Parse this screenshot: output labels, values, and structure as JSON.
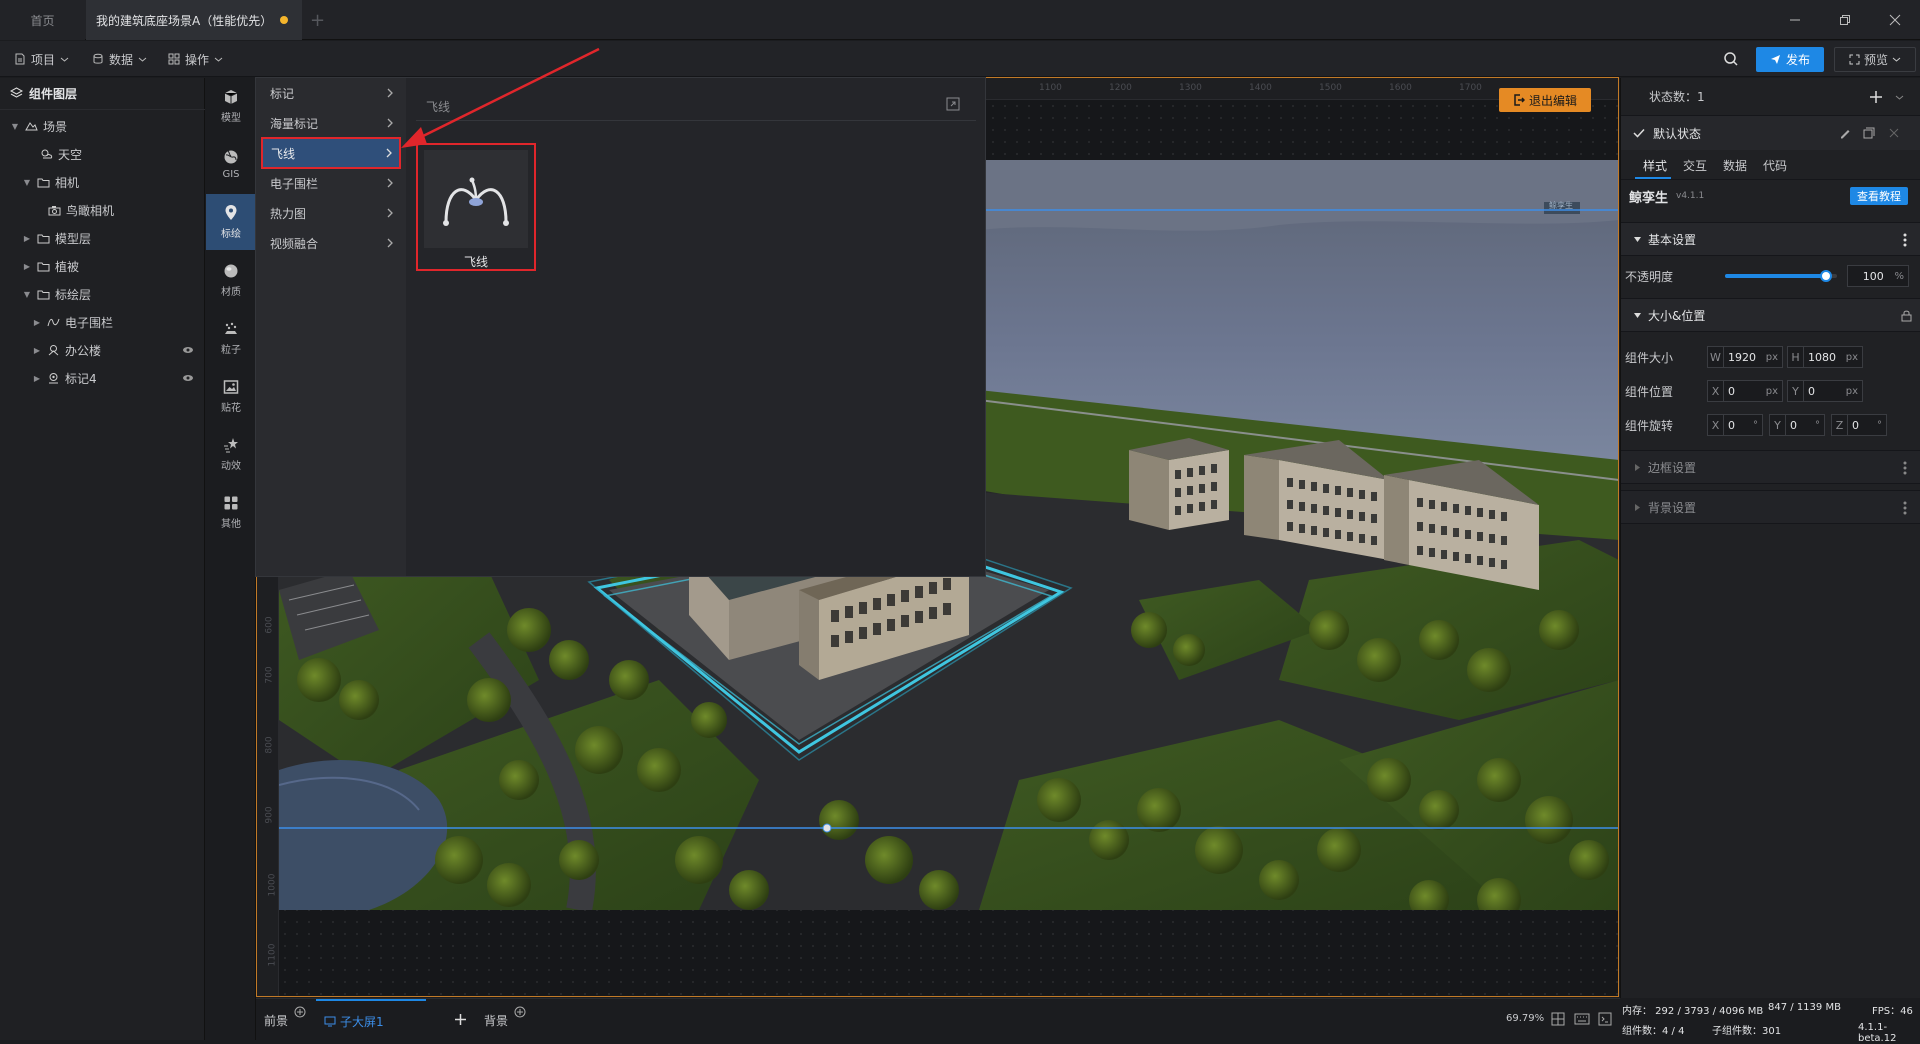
{
  "tabs": {
    "home": "首页",
    "active": "我的建筑底座场景A（性能优先）"
  },
  "toolbar": {
    "project": "项目",
    "data": "数据",
    "operate": "操作",
    "publish": "发布",
    "preview": "预览"
  },
  "layers": {
    "title": "组件图层",
    "items": [
      "场景",
      "天空",
      "相机",
      "鸟瞰相机",
      "模型层",
      "植被",
      "标绘层",
      "电子围栏",
      "办公楼",
      "标记4"
    ]
  },
  "iconbar": {
    "items": [
      "模型",
      "GIS",
      "标绘",
      "材质",
      "粒子",
      "贴花",
      "动效",
      "其他"
    ]
  },
  "flyout": {
    "menu": [
      "标记",
      "海量标记",
      "飞线",
      "电子围栏",
      "热力图",
      "视频融合"
    ],
    "panel_title": "飞线",
    "card_label": "飞线"
  },
  "canvas": {
    "exit_label": "退出编辑",
    "ruler_x": [
      "1100",
      "1200",
      "1300",
      "1400",
      "1500",
      "1600",
      "1700"
    ],
    "ruler_y": [
      "600",
      "700",
      "800",
      "900",
      "1000",
      "1100"
    ],
    "watermark": "鲸孪生"
  },
  "right": {
    "state_count": "状态数：1",
    "default_state": "默认状态",
    "tabs": [
      "样式",
      "交互",
      "数据",
      "代码"
    ],
    "brand": "鲸孪生",
    "version": "v4.1.1",
    "tutorial": "查看教程",
    "basic": "基本设置",
    "opacity_label": "不透明度",
    "opacity_value": "100",
    "opacity_unit": "%",
    "opacity_fraction": 0.9,
    "sizepos": "大小&位置",
    "size_label": "组件大小",
    "w": "1920",
    "h": "1080",
    "pos_label": "组件位置",
    "x": "0",
    "y": "0",
    "rot_label": "组件旋转",
    "rx": "0",
    "ry": "0",
    "rz": "0",
    "px": "px",
    "deg": "°",
    "border": "边框设置",
    "background": "背景设置"
  },
  "bottom": {
    "front": "前景",
    "child": "子大屏1",
    "back": "背景",
    "zoom": "69.79%"
  },
  "status": {
    "mem": "内存： 292 / 3793 / 4096 MB",
    "mem2": "847 / 1139 MB",
    "fps": "FPS：46",
    "count": "组件数：4 / 4",
    "sub": "子组件数：301",
    "ver": "4.1.1-beta.12"
  },
  "colors": {
    "accent": "#1e88e5",
    "highlight": "#e0262b",
    "frame": "#c27a27"
  }
}
